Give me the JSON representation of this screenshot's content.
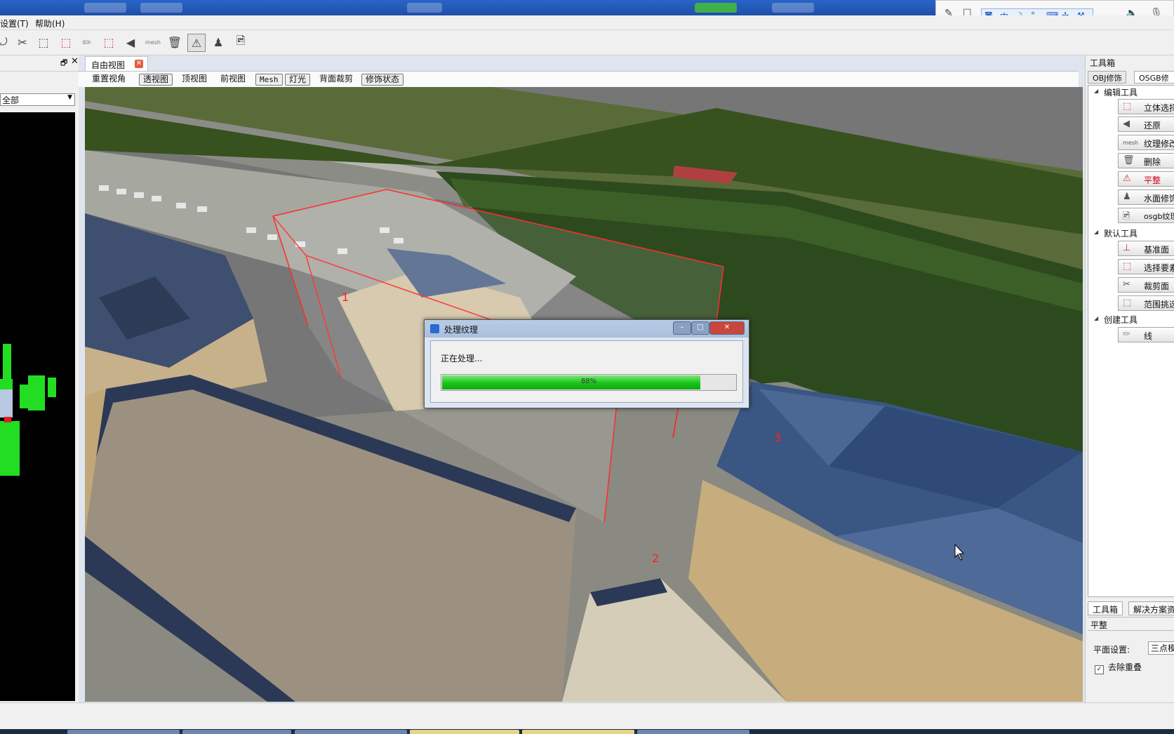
{
  "menu": {
    "settings": "设置(T)",
    "help": "帮助(H)"
  },
  "toolbar": {
    "icons": [
      "select-icon",
      "scissors-icon",
      "range-select-icon",
      "box-select-icon",
      "pencil-icon",
      "stereo-select-icon",
      "undo-icon",
      "mesh-texture-icon",
      "trash-icon",
      "flatten-icon",
      "water-icon",
      "osgb-texture-icon"
    ],
    "mesh_caption": "mesh"
  },
  "left_panel": {
    "select_value": "全部"
  },
  "tabs": {
    "free_view": "自由视图"
  },
  "view_bar": [
    "重置视角",
    "透视图",
    "顶视图",
    "前视图",
    "Mesh",
    "灯光",
    "背面裁剪",
    "修饰状态"
  ],
  "scene": {
    "markers": [
      "1",
      "2",
      "3"
    ]
  },
  "dialog": {
    "title": "处理纹理",
    "message": "正在处理...",
    "progress_text": "88%",
    "progress": 0.88
  },
  "right_panel": {
    "title": "工具箱",
    "tabs": [
      "OBJ修饰",
      "OSGB修饰"
    ],
    "groups": [
      {
        "label": "编辑工具",
        "tools": [
          "立体选择",
          "还原",
          "纹理修改",
          "删除",
          "平整",
          "水面修饰",
          "osgb纹理"
        ]
      },
      {
        "label": "默认工具",
        "tools": [
          "基准面",
          "选择要素",
          "裁剪面",
          "范围挑选"
        ]
      },
      {
        "label": "创建工具",
        "tools": [
          "线"
        ]
      }
    ],
    "bottom_tabs": [
      "工具箱",
      "解决方案资"
    ],
    "section": "平整",
    "plane_label": "平面设置:",
    "plane_value": "三点模",
    "dedupe_label": "去除重叠",
    "dedupe_checked": true,
    "active_color": "#d0021b"
  }
}
